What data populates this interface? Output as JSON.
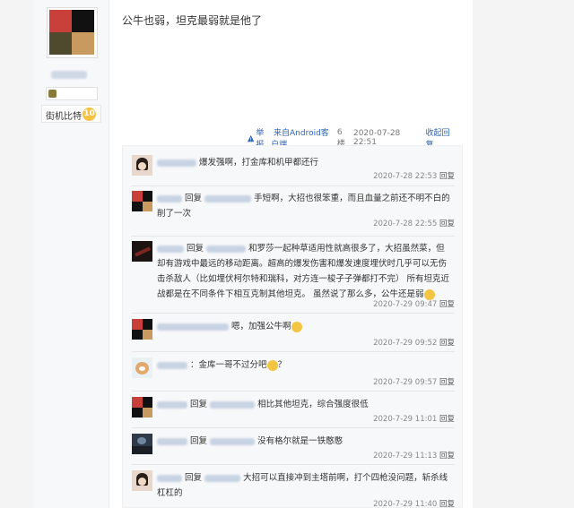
{
  "sidebar": {
    "level_label": "街机比特",
    "level_num": "10"
  },
  "post": {
    "text": "公牛也弱，坦克最弱就是他了",
    "report": "举报",
    "source": "来自Android客户端",
    "floor": "6楼",
    "time": "2020-07-28 22:51",
    "collapse": "收起回复"
  },
  "replies": [
    {
      "prefix": "",
      "text": "爆发强啊，打金库和机甲都还行",
      "time": "2020-7-28 22:53",
      "reply": "回复"
    },
    {
      "prefix": "回复",
      "text": "手短啊，大招也很笨重，而且血量之前还不明不白的削了一次",
      "time": "2020-7-28 22:55",
      "reply": "回复"
    },
    {
      "prefix": "回复",
      "text": "和罗莎一起种草适用性就高很多了，大招虽然菜，但却有游戏中最远的移动距离。超高的爆发伤害和爆发速度埋伏时几乎可以无伤击杀敌人（比如埋伏柯尔特和瑞科，对方连一梭子子弹都打不完） 所有坦克近战都是在不同条件下相互克制其他坦克。 虽然说了那么多，公牛还是弱",
      "time": "2020-7-29 09:47",
      "reply": "回复"
    },
    {
      "prefix": "",
      "text": "嗯，加强公牛啊",
      "time": "2020-7-29 09:52",
      "reply": "回复"
    },
    {
      "prefix": "",
      "text": "：金库一哥不过分吧",
      "suffix": "？",
      "time": "2020-7-29 09:57",
      "reply": "回复"
    },
    {
      "prefix": "回复",
      "text": "相比其他坦克，综合强度很低",
      "time": "2020-7-29 11:01",
      "reply": "回复"
    },
    {
      "prefix": "回复",
      "text": "没有格尔就是一铁憨憨",
      "time": "2020-7-29 11:13",
      "reply": "回复"
    },
    {
      "prefix": "回复",
      "text": "大招可以直接冲到主塔前啊，打个四枪没问题，斩杀线杠杠的",
      "time": "2020-7-29 11:40",
      "reply": "回复"
    }
  ]
}
